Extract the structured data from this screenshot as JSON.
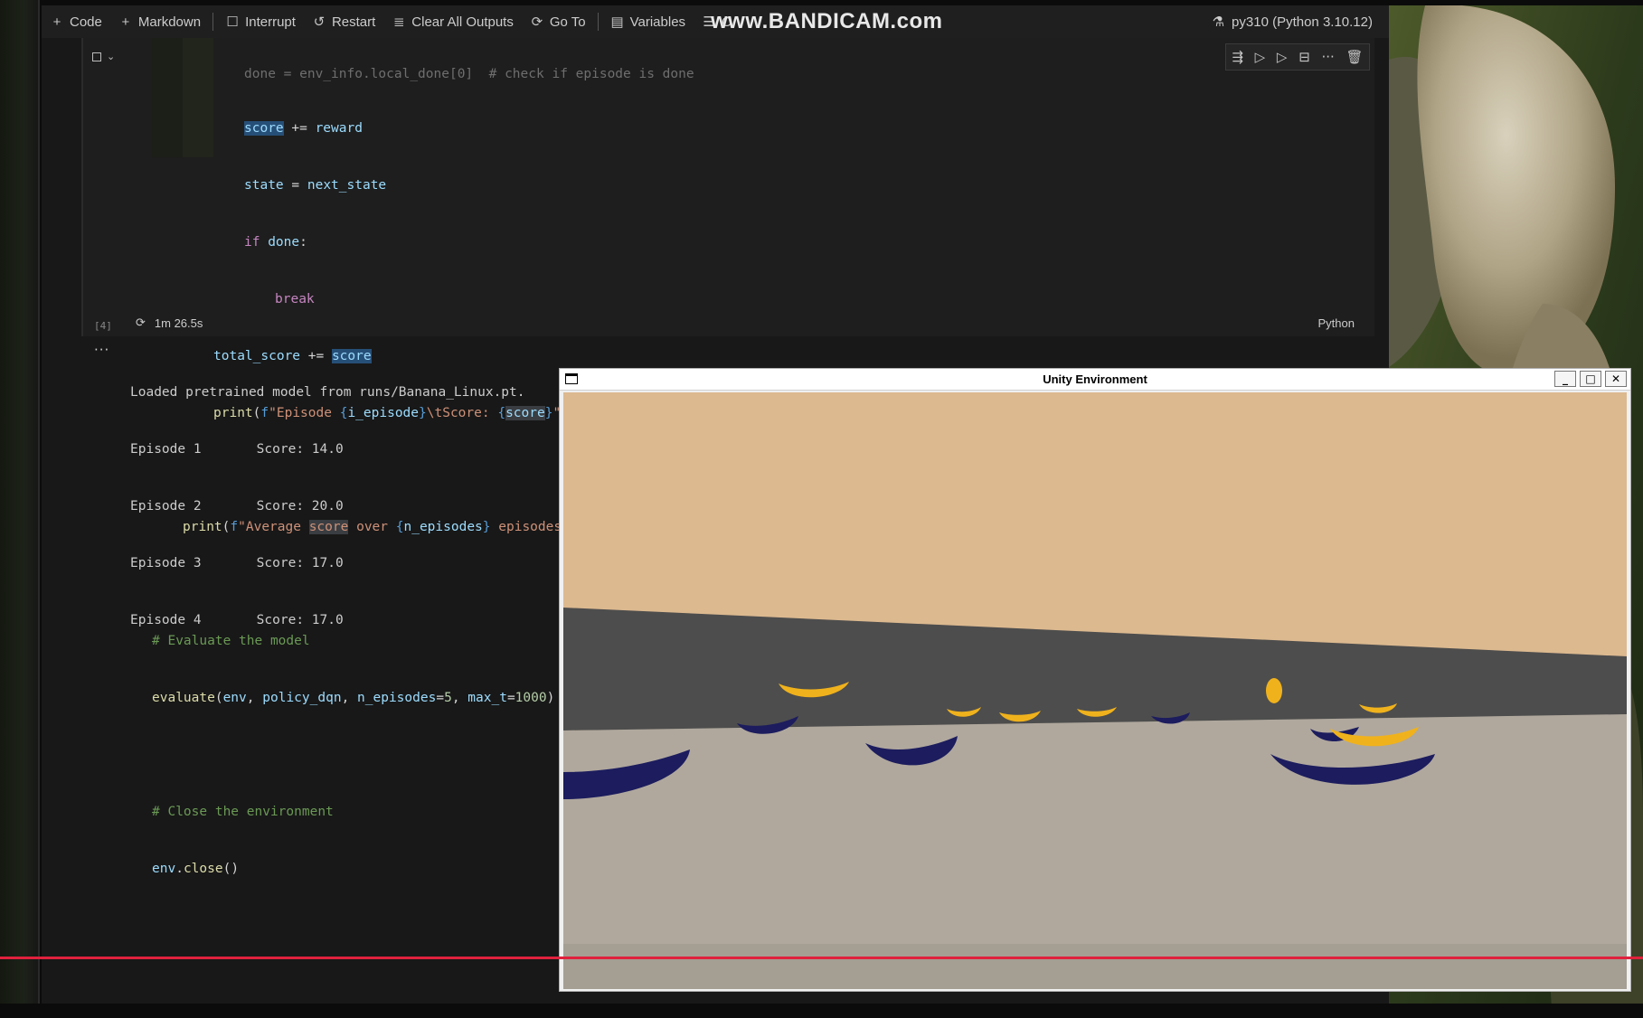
{
  "toolbar": {
    "code": "Code",
    "markdown": "Markdown",
    "interrupt": "Interrupt",
    "restart": "Restart",
    "clear_all_outputs": "Clear All Outputs",
    "go_to": "Go To",
    "variables": "Variables",
    "outline_partial": "O",
    "watermark": "www.BANDICAM.com",
    "kernel": "py310 (Python 3.10.12)"
  },
  "cell": {
    "partial_top_line": "done = env_info.local_done[0]  # check if episode is done",
    "code_lines": [
      "score += reward",
      "state = next_state",
      "if done:",
      "break",
      "total_score += score",
      "print(f\"Episode {i_episode}\\tScore: {score}\")",
      "",
      "print(f\"Average score over {n_episodes} episodes: {total_score / n_episodes}\")",
      "",
      "# Evaluate the model",
      "evaluate(env, policy_dqn, n_episodes=5, max_t=1000)",
      "",
      "# Close the environment",
      "env.close()"
    ],
    "execution_count": "[4]",
    "execution_time": "1m 26.5s",
    "language": "Python"
  },
  "output": {
    "lines": [
      "Loaded pretrained model from runs/Banana_Linux.pt.",
      "Episode 1       Score: 14.0",
      "Episode 2       Score: 20.0",
      "Episode 3       Score: 17.0",
      "Episode 4       Score: 17.0"
    ]
  },
  "unity_window": {
    "title": "Unity Environment"
  },
  "colors": {
    "red_line": "#e0213d",
    "sky": "#dcb98f",
    "wall": "#4d4d4d",
    "floor": "#b0a89d",
    "blue_banana": "#1c1c5e",
    "yellow_banana": "#f0b21c"
  }
}
